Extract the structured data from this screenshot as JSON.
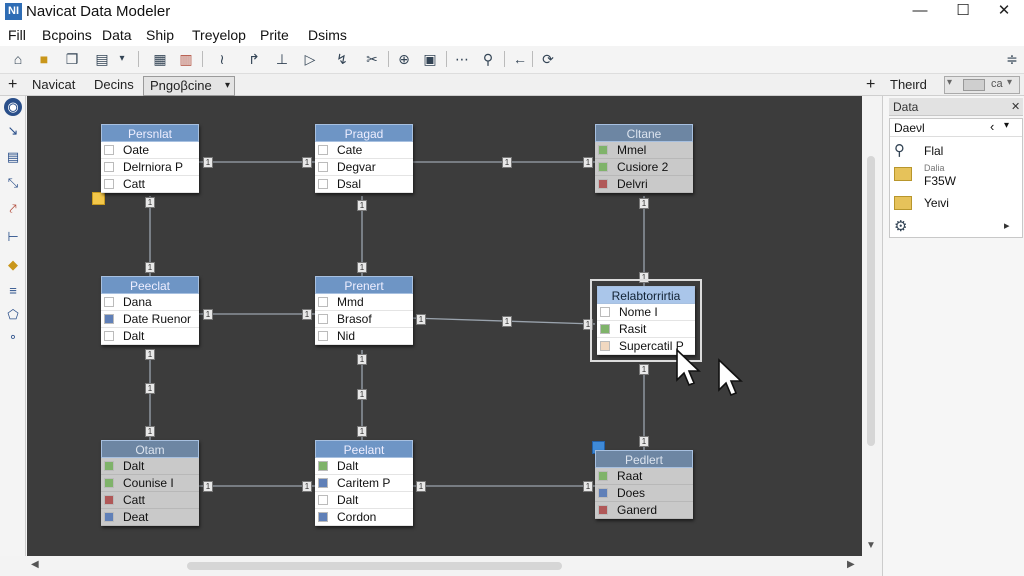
{
  "window": {
    "title": "Navicat Data Modeler",
    "app_icon": "NI",
    "minimize": "—",
    "maximize": "☐",
    "close": "✕"
  },
  "menu": [
    "Fill",
    "Bcpoins",
    "Data",
    "Ship",
    "Treyelop",
    "Prite",
    "Dsims"
  ],
  "tabs": {
    "add": "+",
    "tab1": "Navicat",
    "tab2": "Decins",
    "tab3": "Pngoβcine",
    "tab3_arrow": "▾"
  },
  "right_tabs": {
    "add": "+",
    "label": "Theιrd",
    "combo_text": "ca",
    "combo_arrow": "▾"
  },
  "panel": {
    "title": "Data",
    "close": "✕",
    "search_value": "Daeνl",
    "nav_prev": "‹",
    "nav_next": "▾",
    "items": [
      {
        "label": "Flal",
        "sublabel": ""
      },
      {
        "label": "F35W",
        "sublabel": "Dalia"
      },
      {
        "label": "Yeιvi",
        "sublabel": ""
      }
    ],
    "footer_arrow": "▸"
  },
  "entities": [
    {
      "title": "Persnlat",
      "rows": [
        "Oate",
        "Delrniora P",
        "Catt"
      ]
    },
    {
      "title": "Pragad",
      "rows": [
        "Cate",
        "Degvar",
        "Dsal"
      ]
    },
    {
      "title": "Cltane",
      "rows": [
        "Mmel",
        "Cusiore 2",
        "Delvri"
      ]
    },
    {
      "title": "Peeclat",
      "rows": [
        "Dana",
        "Date Ruenor",
        "Dalt"
      ]
    },
    {
      "title": "Prenert",
      "rows": [
        "Mmd",
        "Brasof",
        "Nid"
      ]
    },
    {
      "title": "Relabtorrirtia",
      "rows": [
        "Nome I",
        "Rasit",
        "Supercatil P"
      ]
    },
    {
      "title": "Otam",
      "rows": [
        "Dalt",
        "Counise I",
        "Catt",
        "Deat"
      ]
    },
    {
      "title": "Peelant",
      "rows": [
        "Dalt",
        "Caritem P",
        "Dalt",
        "Cordon"
      ]
    },
    {
      "title": "Pedlert",
      "rows": [
        "Raat",
        "Does",
        "Ganerd"
      ]
    }
  ],
  "connector_labels": [
    "1",
    "1",
    "1",
    "1",
    "1",
    "1",
    "1",
    "1",
    "1",
    "1",
    "1",
    "1",
    "1"
  ],
  "colors": {
    "canvas": "#3c3c3c",
    "header": "#6e95c5",
    "key_green": "#7fb36a",
    "key_blue": "#6080b8",
    "key_red": "#b05858",
    "note_yellow": "#f3c74a",
    "note_blue": "#3f8ad8"
  }
}
